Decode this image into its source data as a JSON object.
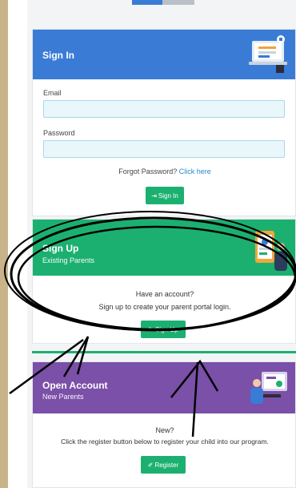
{
  "signin": {
    "title": "Sign In",
    "email_label": "Email",
    "email_value": "",
    "password_label": "Password",
    "password_value": "",
    "forgot_text": "Forgot Password?",
    "forgot_link": "Click here",
    "button_label": "Sign In"
  },
  "signup": {
    "title": "Sign Up",
    "subtitle": "Existing Parents",
    "question": "Have an account?",
    "description": "Sign up to create your parent portal login.",
    "button_label": "Sign Up"
  },
  "open_account": {
    "title": "Open Account",
    "subtitle": "New Parents",
    "question": "New?",
    "description": "Click the register button below to register your child into our program.",
    "button_label": "Register"
  },
  "colors": {
    "primary_blue": "#3a7bd5",
    "success_green": "#1cb070",
    "purple": "#7b50a8",
    "input_bg": "#e9f7fb"
  }
}
